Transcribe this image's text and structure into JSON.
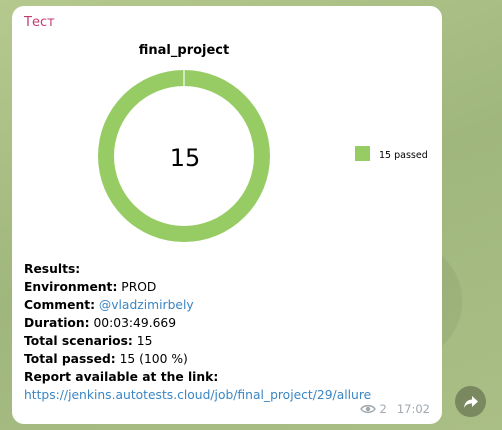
{
  "message": {
    "sender": "Тест",
    "report": {
      "results_label": "Results:",
      "environment_label": "Environment:",
      "environment_value": "PROD",
      "comment_label": "Comment:",
      "comment_value": "@vladzimirbely",
      "duration_label": "Duration:",
      "duration_value": "00:03:49.669",
      "total_scenarios_label": "Total scenarios:",
      "total_scenarios_value": "15",
      "total_passed_label": "Total passed:",
      "total_passed_value": "15 (100 %)",
      "report_link_label": "Report available at the link:",
      "report_link_url": "https://jenkins.autotests.cloud/job/final_project/29/allure"
    },
    "views": "2",
    "time": "17:02"
  },
  "chart_data": {
    "type": "pie",
    "style": "donut",
    "title": "final_project",
    "center_label": "15",
    "slices": [
      {
        "label": "passed",
        "value": 15,
        "color": "#97cc64"
      }
    ],
    "legend": [
      "15 passed"
    ],
    "legend_position": "right"
  },
  "icons": {
    "views": "eye-icon",
    "share": "share-arrow-icon"
  }
}
